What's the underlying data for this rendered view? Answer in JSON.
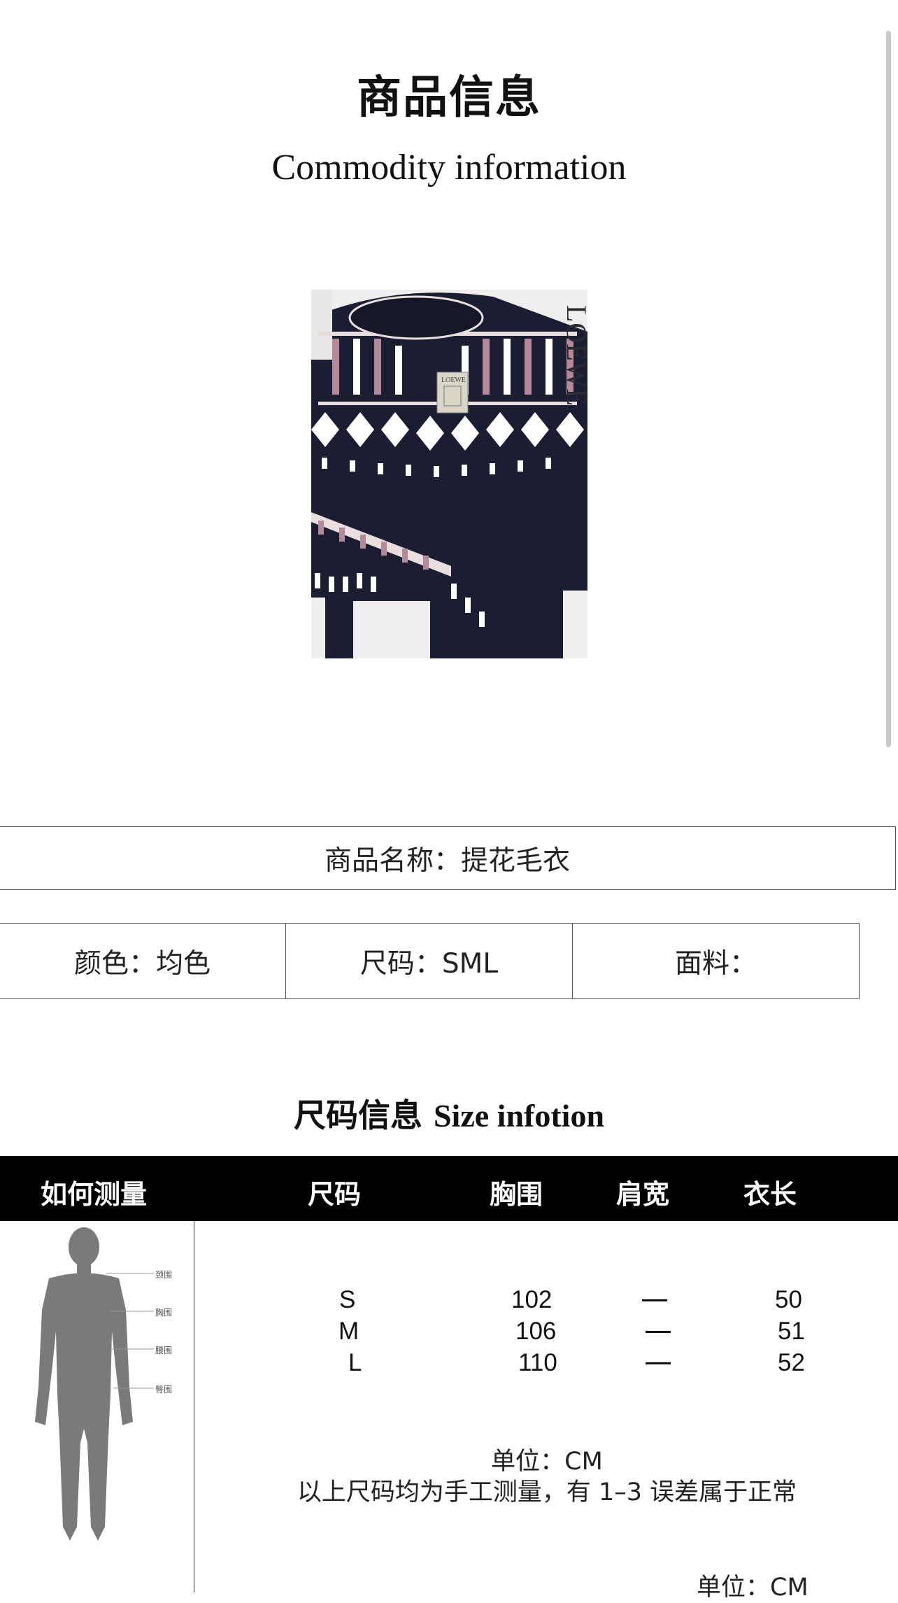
{
  "header": {
    "title_cn": "商品信息",
    "title_en": "Commodity information"
  },
  "product_image": {
    "brand_text_side": "LOEWE",
    "brand_text_chest": "LOEWE"
  },
  "info": {
    "name": "商品名称：提花毛衣",
    "color": "颜色：均色",
    "size": "尺码：SML",
    "fabric": "面料："
  },
  "size_section": {
    "title_cn": "尺码信息",
    "title_en": "Size infotion",
    "headers": [
      "如何测量",
      "尺码",
      "胸围",
      "肩宽",
      "衣长"
    ],
    "figure_labels": [
      "颈围",
      "胸围",
      "腰围",
      "臀围"
    ],
    "rows": [
      {
        "size": "S",
        "chest": "102",
        "shoulder": "—",
        "length": "50"
      },
      {
        "size": "M",
        "chest": "106",
        "shoulder": "—",
        "length": "51"
      },
      {
        "size": "L",
        "chest": "110",
        "shoulder": "—",
        "length": "52"
      }
    ],
    "unit": "单位：CM",
    "note": "以上尺码均为手工测量，有 1–3 误差属于正常",
    "unit_bottom": "单位：CM"
  },
  "colors": {
    "header_bg": "#000000",
    "sweater_navy": "#1b1d33",
    "silhouette": "#7a7a7a"
  }
}
